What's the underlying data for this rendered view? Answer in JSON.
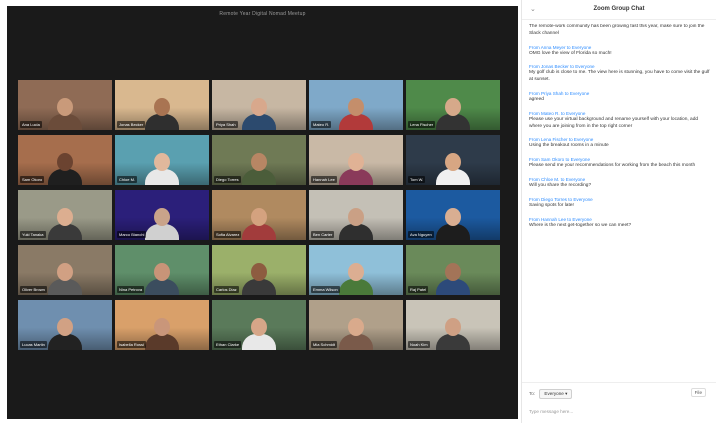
{
  "meeting": {
    "title": "Remote Year Digital Nomad Meetup"
  },
  "tiles": [
    {
      "name": "Ana Lucia",
      "bg": "#8f6b55",
      "skin": "#c99a7a",
      "shirt": "#6b4c3a"
    },
    {
      "name": "Jonas Becker",
      "bg": "#d9b88f",
      "skin": "#a97452",
      "shirt": "#2f2f2f"
    },
    {
      "name": "Priya Shah",
      "bg": "#c7b7a3",
      "skin": "#d8a88c",
      "shirt": "#2c4a6e"
    },
    {
      "name": "Mateo R.",
      "bg": "#7fa9c9",
      "skin": "#c48e6b",
      "shirt": "#b23a3a"
    },
    {
      "name": "Lena Fischer",
      "bg": "#4f8a4a",
      "skin": "#d6a98a",
      "shirt": "#333333"
    },
    {
      "name": "Sam Okoro",
      "bg": "#a66e4d",
      "skin": "#6b4330",
      "shirt": "#1f1f1f"
    },
    {
      "name": "Chloe M.",
      "bg": "#5aa0b0",
      "skin": "#e1b89c",
      "shirt": "#e8e8e8"
    },
    {
      "name": "Diego Torres",
      "bg": "#6f7a55",
      "skin": "#b78664",
      "shirt": "#4b5d3a"
    },
    {
      "name": "Hannah Lee",
      "bg": "#c9b9a6",
      "skin": "#e0b295",
      "shirt": "#8a3a5a"
    },
    {
      "name": "Tom W.",
      "bg": "#2e3b4a",
      "skin": "#d7a683",
      "shirt": "#f0f0f0"
    },
    {
      "name": "Yuki Tanaka",
      "bg": "#9a9a88",
      "skin": "#dcae90",
      "shirt": "#3a3a3a"
    },
    {
      "name": "Marco Bianchi",
      "bg": "#2b1f7a",
      "skin": "#c9a38a",
      "shirt": "#d0d0d0"
    },
    {
      "name": "Sofia Alvarez",
      "bg": "#b08a60",
      "skin": "#d4a27f",
      "shirt": "#a23c3c"
    },
    {
      "name": "Ben Carter",
      "bg": "#c4c0b6",
      "skin": "#caa085",
      "shirt": "#2f2f2f"
    },
    {
      "name": "Ava Nguyen",
      "bg": "#1c5aa0",
      "skin": "#d9ae92",
      "shirt": "#1d1d1d"
    },
    {
      "name": "Oliver Brown",
      "bg": "#8a7a66",
      "skin": "#d1a083",
      "shirt": "#5a5a5a"
    },
    {
      "name": "Nina Petrova",
      "bg": "#5f8f6a",
      "skin": "#c89478",
      "shirt": "#3b4d5e"
    },
    {
      "name": "Carlos Diaz",
      "bg": "#9bb06a",
      "skin": "#8d5c40",
      "shirt": "#3a3a3a"
    },
    {
      "name": "Emma Wilson",
      "bg": "#8fc0d9",
      "skin": "#dcae92",
      "shirt": "#4a7a3a"
    },
    {
      "name": "Raj Patel",
      "bg": "#6a8a5a",
      "skin": "#a37458",
      "shirt": "#2d4a7a"
    },
    {
      "name": "Lucas Martin",
      "bg": "#6f8faf",
      "skin": "#d1a184",
      "shirt": "#222222"
    },
    {
      "name": "Isabella Rossi",
      "bg": "#d9a06a",
      "skin": "#c9967a",
      "shirt": "#5a3a2a"
    },
    {
      "name": "Ethan Clarke",
      "bg": "#5a7a5a",
      "skin": "#d6a688",
      "shirt": "#e8e8e8"
    },
    {
      "name": "Mia Schmidt",
      "bg": "#b0a08a",
      "skin": "#d9aa8c",
      "shirt": "#7a5a4a"
    },
    {
      "name": "Noah Kim",
      "bg": "#c9c4b8",
      "skin": "#cfa084",
      "shirt": "#3a3a3a"
    }
  ],
  "chat": {
    "collapse_icon": "chevron-down-icon",
    "title": "Zoom Group Chat",
    "messages": [
      {
        "sender": "",
        "text": "The remote-work community has been growing fast this year, make sure to join the Slack channel"
      },
      {
        "sender": "From Anna Meyer to Everyone",
        "text": "OMG love the view of Florida so much!"
      },
      {
        "sender": "From Jonas Becker to Everyone",
        "text": "My golf club is close to me. The view here is stunning, you have to come visit the gulf at sunset."
      },
      {
        "sender": "From Priya Shah to Everyone",
        "text": "agreed"
      },
      {
        "sender": "From Mateo R. to Everyone",
        "text": "Please use your virtual background and rename yourself with your location, add where you are joining from in the top right corner"
      },
      {
        "sender": "From Lena Fischer to Everyone",
        "text": "Using the breakout rooms in a minute"
      },
      {
        "sender": "From Sam Okoro to Everyone",
        "text": "Please send me your recommendations for working from the beach this month"
      },
      {
        "sender": "From Chloe M. to Everyone",
        "text": "Will you share the recording?"
      },
      {
        "sender": "From Diego Torres to Everyone",
        "text": "Saving spots for later"
      },
      {
        "sender": "From Hannah Lee to Everyone",
        "text": "Where is the next get-together so we can meet?"
      }
    ],
    "to_label": "To:",
    "to_value": "Everyone",
    "file_label": "File",
    "input_placeholder": "Type message here..."
  }
}
